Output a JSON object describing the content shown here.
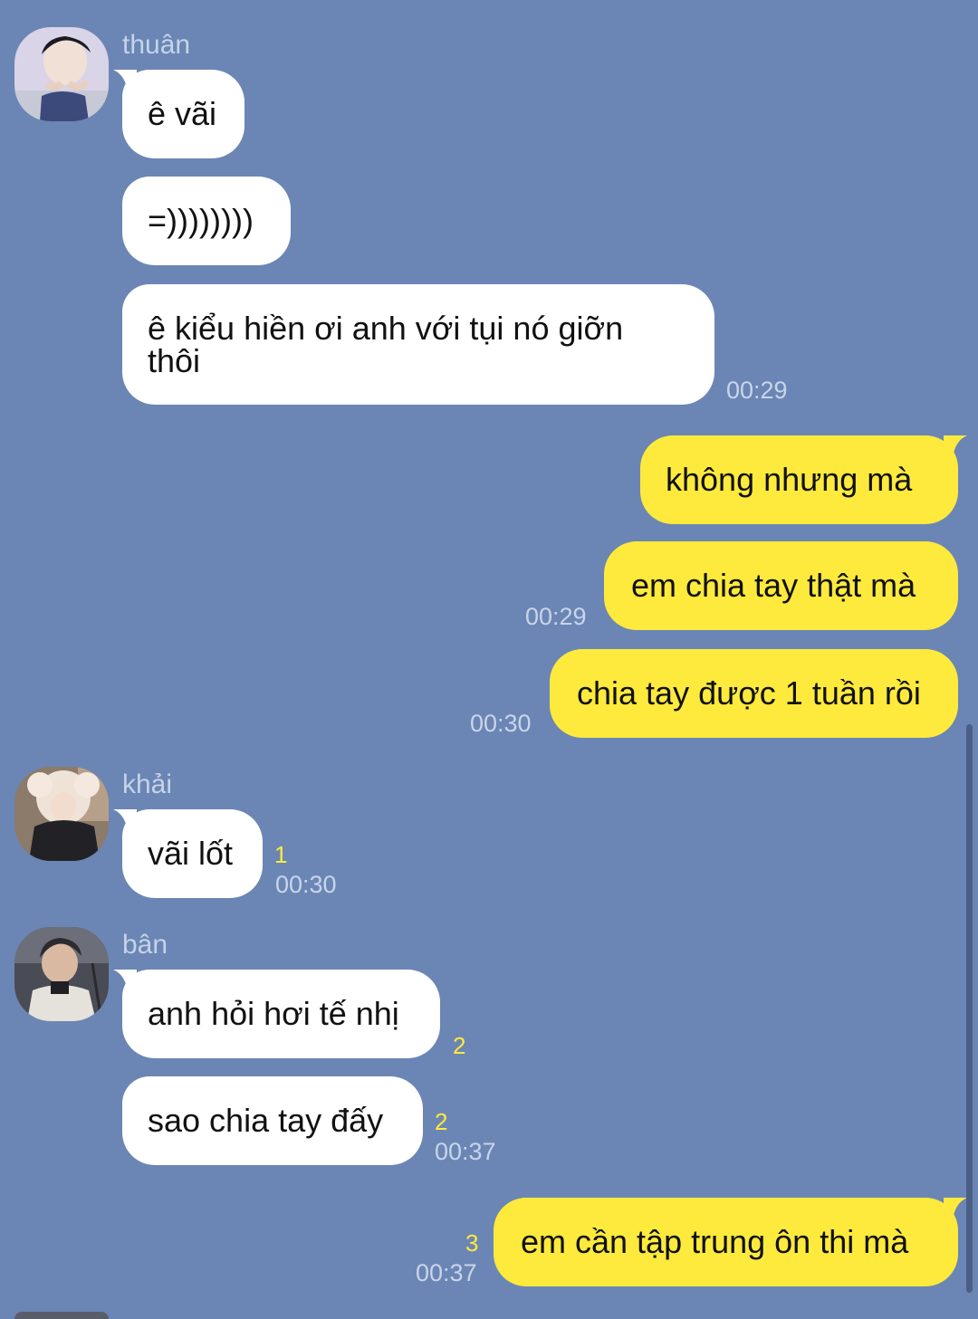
{
  "conversation": {
    "groups": [
      {
        "sender": "thuân",
        "avatar_icon": "profile-photo-avatar",
        "messages": [
          {
            "text": "ê vãi"
          },
          {
            "text": "=))))))))"
          },
          {
            "text": "ê kiểu hiền ơi anh với tụi nó giỡn thôi",
            "time": "00:29"
          }
        ]
      },
      {
        "sender": "me",
        "messages": [
          {
            "text": "không nhưng mà"
          },
          {
            "text": "em chia tay thật mà",
            "time": "00:29"
          },
          {
            "text": "chia tay được 1 tuần rồi",
            "time": "00:30"
          }
        ]
      },
      {
        "sender": "khải",
        "avatar_icon": "profile-photo-avatar",
        "messages": [
          {
            "text": "vãi lốt",
            "unread": "1",
            "time": "00:30"
          }
        ]
      },
      {
        "sender": "bân",
        "avatar_icon": "profile-photo-avatar",
        "messages": [
          {
            "text": "anh hỏi hơi tế nhị",
            "unread": "2"
          },
          {
            "text": "sao chia tay đấy",
            "unread": "2",
            "time": "00:37"
          }
        ]
      },
      {
        "sender": "me",
        "messages": [
          {
            "text": "em cần tập trung ôn thi mà",
            "unread": "3",
            "time": "00:37"
          }
        ]
      }
    ]
  },
  "colors": {
    "background": "#6b86b4",
    "incoming_bubble": "#ffffff",
    "outgoing_bubble": "#fdea3c",
    "unread_count": "#fdea3c",
    "timestamp": "#c8d5ea",
    "sender_name": "#c5d3ea"
  }
}
